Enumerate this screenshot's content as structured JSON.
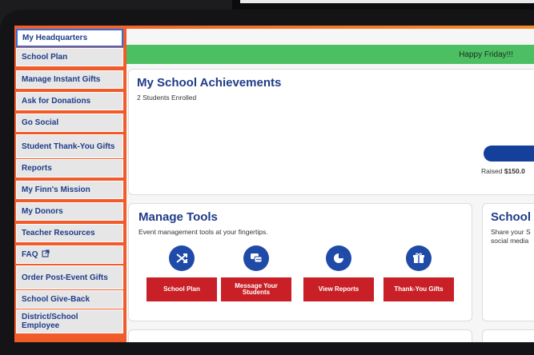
{
  "sidebar": {
    "items": [
      {
        "label": "My Headquarters",
        "active": true
      },
      {
        "label": "School Plan"
      },
      {
        "label": "Manage Instant Gifts"
      },
      {
        "label": "Ask for Donations"
      },
      {
        "label": "Go Social"
      },
      {
        "label": "Student Thank-You Gifts"
      },
      {
        "label": "Reports"
      },
      {
        "label": "My Finn's Mission"
      },
      {
        "label": "My Donors"
      },
      {
        "label": "Teacher Resources"
      },
      {
        "label": "FAQ",
        "external_icon": "external-link-icon"
      },
      {
        "label": "Order Post-Event Gifts"
      },
      {
        "label": "School Give-Back"
      },
      {
        "label": "District/School Employee"
      }
    ]
  },
  "banner": {
    "text": "Happy Friday!!!"
  },
  "achievements": {
    "title": "My School Achievements",
    "enrolled": "2 Students Enrolled",
    "raised_label": "Raised ",
    "raised_amount": "$150.0"
  },
  "tools": {
    "title": "Manage Tools",
    "subtitle": "Event management tools at your fingertips.",
    "buttons": [
      {
        "label": "School Plan",
        "icon": "shuffle-icon"
      },
      {
        "label": "Message Your Students",
        "icon": "chat-icon"
      },
      {
        "label": "View Reports",
        "icon": "pie-chart-icon"
      },
      {
        "label": "Thank-You Gifts",
        "icon": "gift-icon"
      }
    ]
  },
  "school_card": {
    "title": "School",
    "line1": "Share your S",
    "line2": "social media"
  },
  "colors": {
    "accent": "#f15a29",
    "brand_blue": "#1f3c88",
    "button_red": "#c91f26",
    "banner_green": "#4cbf63"
  }
}
